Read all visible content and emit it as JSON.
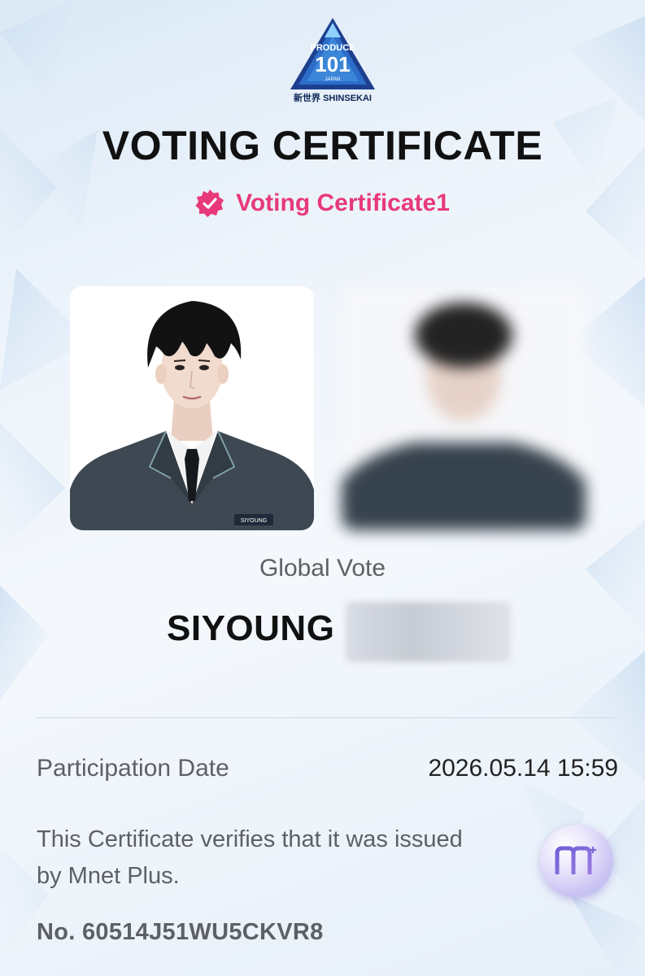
{
  "header": {
    "logo": {
      "icon": "produce-101-japan-logo",
      "text_top": "PRODUCE",
      "text_number": "101",
      "text_country": "JAPAN",
      "text_bottom": "新世界 SHINSEKAI"
    },
    "title": "VOTING CERTIFICATE",
    "subtitle": "Voting Certificate1",
    "subtitle_icon": "verified-badge-icon",
    "accent_color": "#e8397a"
  },
  "photos": {
    "left": {
      "nametag": "SIYOUNG"
    },
    "right": {
      "state": "blurred"
    }
  },
  "vote": {
    "type_label": "Global Vote",
    "name": "SIYOUNG"
  },
  "details": {
    "date_label": "Participation Date",
    "date_value": "2026.05.14 15:59",
    "verify_text": "This Certificate verifies that it was issued by Mnet Plus.",
    "certificate_number": "No. 60514J51WU5CKVR8",
    "issuer_icon": "mnet-plus-logo-icon"
  }
}
